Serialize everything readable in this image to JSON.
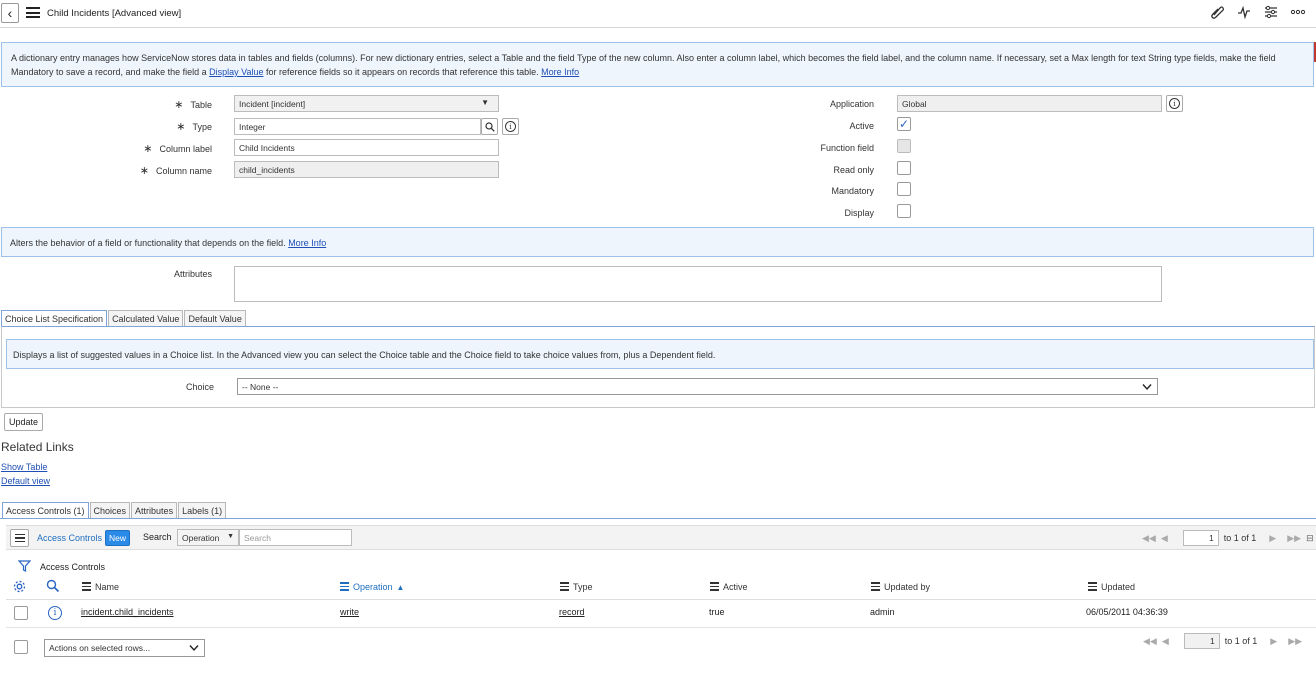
{
  "header": {
    "back_glyph": "‹",
    "title": "Child Incidents [Advanced view]",
    "icons": [
      "paperclip-icon",
      "activity-icon",
      "sliders-icon",
      "more-icon"
    ]
  },
  "intro": {
    "text": "A dictionary entry manages how ServiceNow stores data in tables and fields (columns). For new dictionary entries, select a Table and the field Type of the new column. Also enter a column label, which becomes the field label, and the column name. If necessary, set a Max length for text String type fields, make the field Mandatory to save a record, and make the field a ",
    "link1": "Display Value",
    "text2": " for reference fields so it appears on records that reference this table. ",
    "link2": "More Info"
  },
  "form": {
    "table_label": "Table",
    "table_value": "Incident [incident]",
    "type_label": "Type",
    "type_value": "Integer",
    "column_label_label": "Column label",
    "column_label_value": "Child Incidents",
    "column_name_label": "Column name",
    "column_name_value": "child_incidents",
    "application_label": "Application",
    "application_value": "Global",
    "active_label": "Active",
    "function_field_label": "Function field",
    "read_only_label": "Read only",
    "mandatory_label": "Mandatory",
    "display_label": "Display",
    "required_glyph": "∗"
  },
  "behavior_info": {
    "text": "Alters the behavior of a field or functionality that depends on the field. ",
    "link": "More Info"
  },
  "attributes_label": "Attributes",
  "section_tabs": [
    "Choice List Specification",
    "Calculated Value",
    "Default Value"
  ],
  "choice_info": "Displays a list of suggested values in a Choice list. In the Advanced view you can select the Choice table and the Choice field to take choice values from, plus a Dependent field.",
  "choice_label": "Choice",
  "choice_value": "-- None --",
  "update_button": "Update",
  "related_links": {
    "heading": "Related Links",
    "show_table": "Show Table",
    "default_view": "Default view"
  },
  "related_tabs": [
    "Access Controls (1)",
    "Choices",
    "Attributes",
    "Labels (1)"
  ],
  "list": {
    "title": "Access Controls",
    "new_label": "New",
    "search_label": "Search",
    "search_field": "Operation",
    "search_placeholder": "Search",
    "breadcrumb": "Access Controls",
    "columns": [
      "Name",
      "Operation",
      "Type",
      "Active",
      "Updated by",
      "Updated"
    ],
    "sorted_column": "Operation",
    "rows": [
      {
        "name": "incident.child_incidents",
        "operation": "write",
        "type": "record",
        "active": "true",
        "updated_by": "admin",
        "updated": "06/05/2011 04:36:39"
      }
    ],
    "page_value": "1",
    "page_total": "to 1 of 1",
    "actions_placeholder": "Actions on selected rows..."
  }
}
